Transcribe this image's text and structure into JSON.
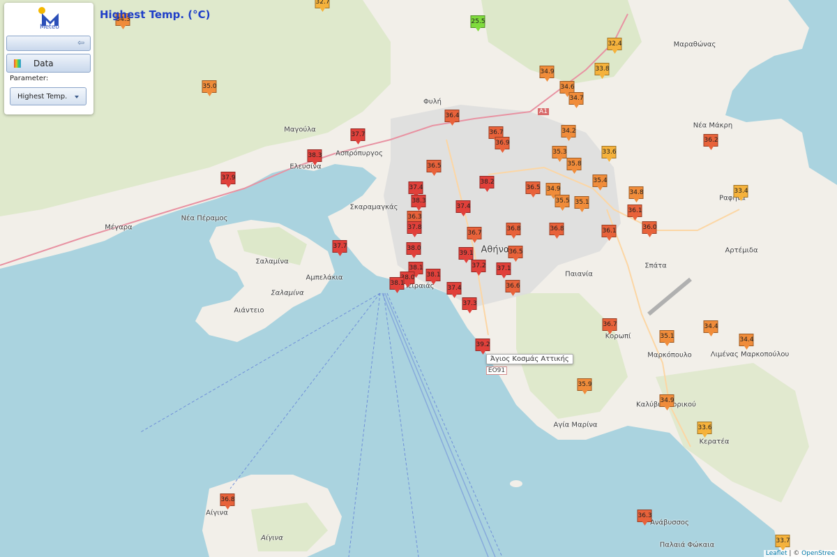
{
  "header": {
    "title": "Highest Temp. (°C)"
  },
  "panel": {
    "logo_text": "Meteo",
    "back_icon": "arrow-left-icon",
    "data_button": "Data",
    "data_icon": "palette-icon",
    "parameter_label": "Parameter:",
    "parameter_value": "Highest Temp."
  },
  "tooltip": "Άγιος Κοσμάς Αττικής",
  "attribution": {
    "leaflet": "Leaflet",
    "sep": " | © ",
    "osm": "OpenStree"
  },
  "places": [
    "Μαραθώνας",
    "Φυλή",
    "Μαγούλα",
    "Ασπρόπυργος",
    "Ελευσίνα",
    "Νέα Μάκρη",
    "Μέγαρα",
    "Νέα Πέραμος",
    "Σκαραμαγκάς",
    "Αθήνα",
    "Ραφήνα",
    "Σαλαμίνα",
    "Αμπελάκια",
    "Σαλαμίνα",
    "Αιάντειο",
    "Πειραιάς",
    "Παιανία",
    "Σπάτα",
    "Αρτέμιδα",
    "Κορωπί",
    "Μαρκόπουλο",
    "Λιμένας Μαρκοπούλου",
    "Καλύβια Θορικού",
    "Αγία Μαρίνα",
    "Κερατέα",
    "Αίγινα",
    "Αίγινα",
    "Ανάβυσσος",
    "Παλαιά Φώκαια",
    "ΕΟ91",
    "Α1"
  ],
  "colors": {
    "sea": "#aad3df",
    "land": "#f2efe9",
    "green": "#cfe3b5",
    "urban": "#dddddd",
    "red": "#e0403a",
    "orange_red": "#e8623a",
    "orange": "#f08c3a",
    "yellow": "#f5b23c",
    "green_marker": "#7fdb3c"
  },
  "stations": [
    {
      "value": "32.7",
      "color": "#f5b23c"
    },
    {
      "value": "34.3",
      "color": "#f08c3a"
    },
    {
      "value": "25.5",
      "color": "#7fdb3c"
    },
    {
      "value": "32.4",
      "color": "#f5b23c"
    },
    {
      "value": "34.9",
      "color": "#f08c3a"
    },
    {
      "value": "33.8",
      "color": "#f5b23c"
    },
    {
      "value": "35.0",
      "color": "#f08c3a"
    },
    {
      "value": "34.6",
      "color": "#f08c3a"
    },
    {
      "value": "34.7",
      "color": "#f08c3a"
    },
    {
      "value": "36.4",
      "color": "#e8623a"
    },
    {
      "value": "36.7",
      "color": "#e8623a"
    },
    {
      "value": "34.2",
      "color": "#f08c3a"
    },
    {
      "value": "37.7",
      "color": "#e0403a"
    },
    {
      "value": "36.9",
      "color": "#e8623a"
    },
    {
      "value": "36.2",
      "color": "#e8623a"
    },
    {
      "value": "38.3",
      "color": "#e0403a"
    },
    {
      "value": "35.3",
      "color": "#f08c3a"
    },
    {
      "value": "33.6",
      "color": "#f5b23c"
    },
    {
      "value": "35.8",
      "color": "#f08c3a"
    },
    {
      "value": "36.5",
      "color": "#e8623a"
    },
    {
      "value": "37.9",
      "color": "#e0403a"
    },
    {
      "value": "38.2",
      "color": "#e0403a"
    },
    {
      "value": "35.4",
      "color": "#f08c3a"
    },
    {
      "value": "37.4",
      "color": "#e0403a"
    },
    {
      "value": "36.5",
      "color": "#e8623a"
    },
    {
      "value": "34.9",
      "color": "#f08c3a"
    },
    {
      "value": "34.8",
      "color": "#f08c3a"
    },
    {
      "value": "33.4",
      "color": "#f5b23c"
    },
    {
      "value": "38.3",
      "color": "#e0403a"
    },
    {
      "value": "35.5",
      "color": "#f08c3a"
    },
    {
      "value": "35.1",
      "color": "#f08c3a"
    },
    {
      "value": "37.4",
      "color": "#e0403a"
    },
    {
      "value": "36.1",
      "color": "#e8623a"
    },
    {
      "value": "36.3",
      "color": "#e8623a"
    },
    {
      "value": "37.8",
      "color": "#e0403a"
    },
    {
      "value": "36.7",
      "color": "#e8623a"
    },
    {
      "value": "36.8",
      "color": "#e8623a"
    },
    {
      "value": "36.8",
      "color": "#e8623a"
    },
    {
      "value": "36.1",
      "color": "#e8623a"
    },
    {
      "value": "36.0",
      "color": "#e8623a"
    },
    {
      "value": "37.7",
      "color": "#e0403a"
    },
    {
      "value": "38.0",
      "color": "#e0403a"
    },
    {
      "value": "39.1",
      "color": "#e0403a"
    },
    {
      "value": "36.5",
      "color": "#e8623a"
    },
    {
      "value": "37.2",
      "color": "#e0403a"
    },
    {
      "value": "37.1",
      "color": "#e0403a"
    },
    {
      "value": "38.1",
      "color": "#e0403a"
    },
    {
      "value": "38.0",
      "color": "#e0403a"
    },
    {
      "value": "38.1",
      "color": "#e0403a"
    },
    {
      "value": "38.1",
      "color": "#e0403a"
    },
    {
      "value": "36.6",
      "color": "#e8623a"
    },
    {
      "value": "37.4",
      "color": "#e0403a"
    },
    {
      "value": "37.3",
      "color": "#e0403a"
    },
    {
      "value": "36.7",
      "color": "#e8623a"
    },
    {
      "value": "34.4",
      "color": "#f08c3a"
    },
    {
      "value": "35.1",
      "color": "#f08c3a"
    },
    {
      "value": "34.4",
      "color": "#f08c3a"
    },
    {
      "value": "39.2",
      "color": "#e0403a"
    },
    {
      "value": "35.9",
      "color": "#f08c3a"
    },
    {
      "value": "34.9",
      "color": "#f08c3a"
    },
    {
      "value": "33.6",
      "color": "#f5b23c"
    },
    {
      "value": "36.8",
      "color": "#e8623a"
    },
    {
      "value": "36.3",
      "color": "#e8623a"
    },
    {
      "value": "33.7",
      "color": "#f5b23c"
    }
  ]
}
